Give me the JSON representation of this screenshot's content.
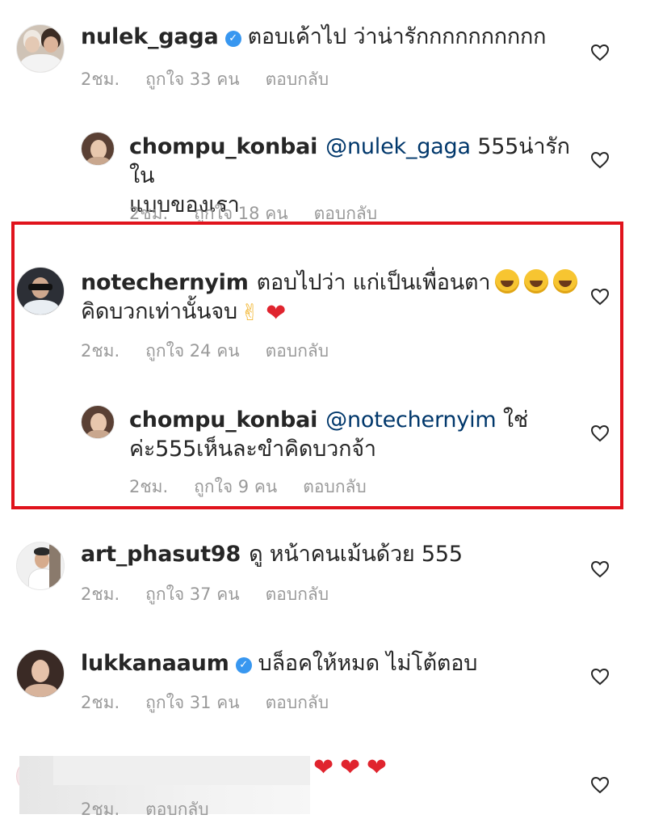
{
  "comments": [
    {
      "username": "nulek_gaga",
      "verified": true,
      "text": "ตอบเค้าไป ว่าน่ารักกกกกกกกกก",
      "time": "2ชม.",
      "likes": "ถูกใจ 33 คน",
      "reply": "ตอบกลับ"
    },
    {
      "username": "chompu_konbai",
      "mention": "@nulek_gaga",
      "text_line1": "555น่ารักใน",
      "text_line2": "แบบของเรา",
      "time": "2ชม.",
      "likes": "ถูกใจ 18 คน",
      "reply": "ตอบกลับ"
    },
    {
      "username": "notechernyim",
      "text_line1": "ตอบไปว่า แก่เป็นเพื่อนตา",
      "text_line2": "คิดบวกเท่านั้นจบ",
      "time": "2ชม.",
      "likes": "ถูกใจ 24 คน",
      "reply": "ตอบกลับ"
    },
    {
      "username": "chompu_konbai",
      "mention": "@notechernyim",
      "text_line1": "ใช่",
      "text_line2": "ค่ะ555เห็นละขำคิดบวกจ้า",
      "time": "2ชม.",
      "likes": "ถูกใจ 9 คน",
      "reply": "ตอบกลับ"
    },
    {
      "username": "art_phasut98",
      "text": "ดู หน้าคนเม้นด้วย 555",
      "time": "2ชม.",
      "likes": "ถูกใจ 37 คน",
      "reply": "ตอบกลับ"
    },
    {
      "username": "lukkanaaum",
      "verified": true,
      "text": "บล็อคให้หมด ไม่โต้ตอบ",
      "time": "2ชม.",
      "likes": "ถูกใจ 31 คน",
      "reply": "ตอบกลับ"
    },
    {
      "time": "2ชม.",
      "reply": "ตอบกลับ"
    }
  ],
  "icons": {
    "verified": "verified-badge-icon",
    "like": "heart-outline-icon",
    "emoji_laugh": "rolling-on-floor-laughing-emoji",
    "emoji_peace": "victory-hand-emoji",
    "emoji_heart": "red-heart-emoji"
  },
  "colors": {
    "highlight_border": "#e0131c",
    "mention": "#00376b",
    "verified": "#3897f0",
    "meta": "#9a9a9a"
  }
}
